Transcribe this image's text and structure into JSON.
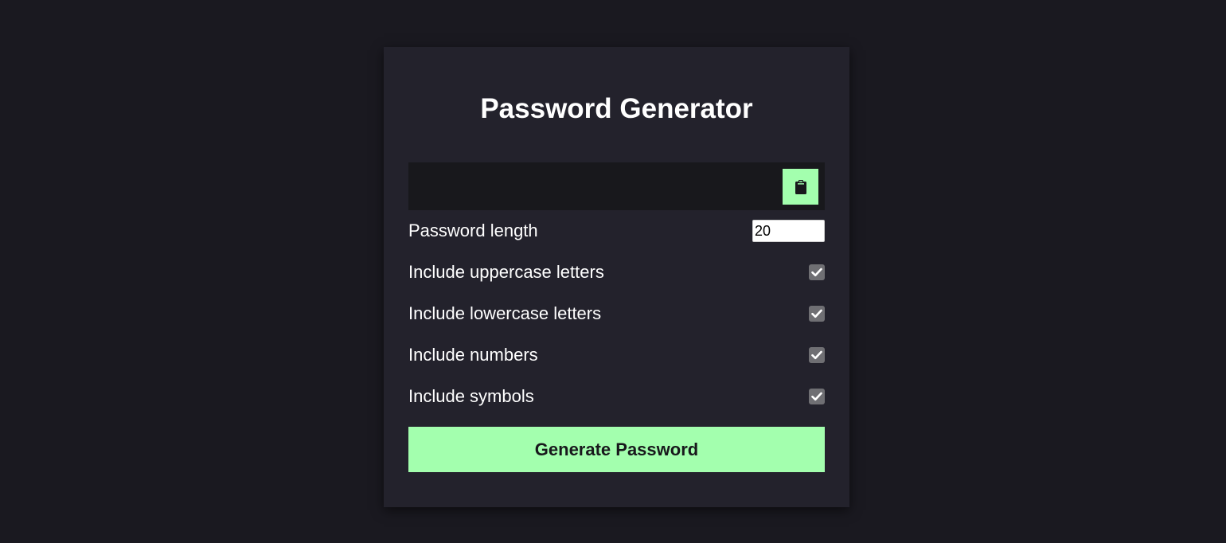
{
  "app": {
    "title": "Password Generator"
  },
  "result": {
    "value": "",
    "copy_icon": "clipboard-icon"
  },
  "settings": {
    "length": {
      "label": "Password length",
      "value": "20"
    },
    "options": [
      {
        "label": "Include uppercase letters",
        "checked": true
      },
      {
        "label": "Include lowercase letters",
        "checked": true
      },
      {
        "label": "Include numbers",
        "checked": true
      },
      {
        "label": "Include symbols",
        "checked": true
      }
    ]
  },
  "generate_button": {
    "label": "Generate Password"
  },
  "colors": {
    "page_background": "#1a1920",
    "card_background": "#23222c",
    "result_background": "#18181c",
    "accent": "#a3ffae",
    "checkbox": "#6f6f73"
  }
}
